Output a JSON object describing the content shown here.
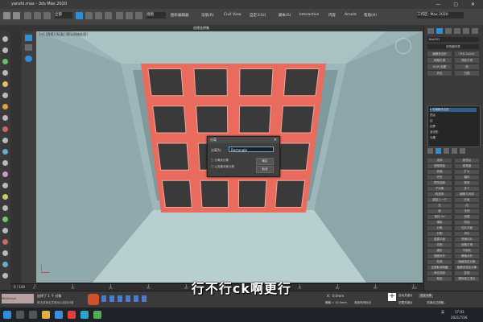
{
  "window": {
    "title": "yanzhi.max - 3ds Max 2020",
    "controls": "— ▢ ✕"
  },
  "toolbar": {
    "selection_filter": "全部",
    "view_dropdown": "视图",
    "selection_set": "创建选择集",
    "menu_items": [
      "图形编辑器",
      "渲染(R)",
      "Civil View",
      "自定义(U)",
      "脚本(S)",
      "Interactive",
      "内容",
      "Arnold",
      "帮助(H)"
    ],
    "workspace": "工作区: Max 2020"
  },
  "viewport": {
    "label": "[+] [透视] [标准] [默认明暗处理]",
    "grid_rows": 4,
    "grid_cols": 4,
    "colors": {
      "frame": "#e96b5e",
      "pane": "#3a3a3a",
      "wall": "#9ab4b7",
      "floor": "#b7cfcf"
    }
  },
  "dialog": {
    "title": "分离",
    "name_label": "分离为:",
    "name_value": "Rectangle",
    "opt1": "分离到元素",
    "opt2": "以克隆对象分离",
    "ok": "确定",
    "cancel": "取消"
  },
  "command_panel": {
    "object_name": "Box001",
    "section_label": "修改器列表",
    "buttons": [
      "编辑多边形",
      "FFD 2x2x2",
      "网格平滑",
      "涡轮平滑",
      "UVW 贴图",
      "壳",
      "挤出",
      "扫描"
    ],
    "stack": [
      "可编辑多边形",
      "顶点",
      "边",
      "边界",
      "多边形",
      "元素"
    ],
    "panel_labels": [
      "选择",
      "按顶点",
      "忽略背面",
      "按角度",
      "收缩",
      "扩大",
      "环形",
      "循环",
      "预览选择",
      "禁用",
      "子对象",
      "多个",
      "软选择",
      "编辑几何体",
      "重复上一个",
      "约束",
      "无",
      "边",
      "面",
      "法线",
      "保持 UV",
      "创建",
      "塌陷",
      "附加",
      "分离",
      "切片平面",
      "分割",
      "切片",
      "重置平面",
      "快速切片",
      "切割",
      "网格平滑",
      "细化",
      "平面化",
      "视图对齐",
      "栅格对齐",
      "松弛",
      "隐藏选定对象",
      "全部取消隐藏",
      "隐藏未选定对象",
      "命名选择",
      "复制",
      "粘贴",
      "删除孤立顶点"
    ]
  },
  "status": {
    "selection_info": "选择了 1 个 对象",
    "hint": "单击或单击并拖动以选择对象",
    "x_label": "X:",
    "x_value": "0.0mm",
    "grid": "栅格 = 10.0mm",
    "add_time_tag": "添加时间标记",
    "auto_key": "自动关键点",
    "set_key": "设置关键点",
    "selected_obj": "选定对象",
    "key_filter": "关键点过滤器...",
    "frame": "0 / 100"
  },
  "timeline": {
    "ticks": [
      "0",
      "10",
      "20",
      "30",
      "40",
      "50",
      "60",
      "70",
      "80",
      "90",
      "100"
    ]
  },
  "taskbar": {
    "time": "17:03",
    "date": "2021/7/26",
    "lang": "英"
  },
  "subtitle": "行不行ck啊更行"
}
